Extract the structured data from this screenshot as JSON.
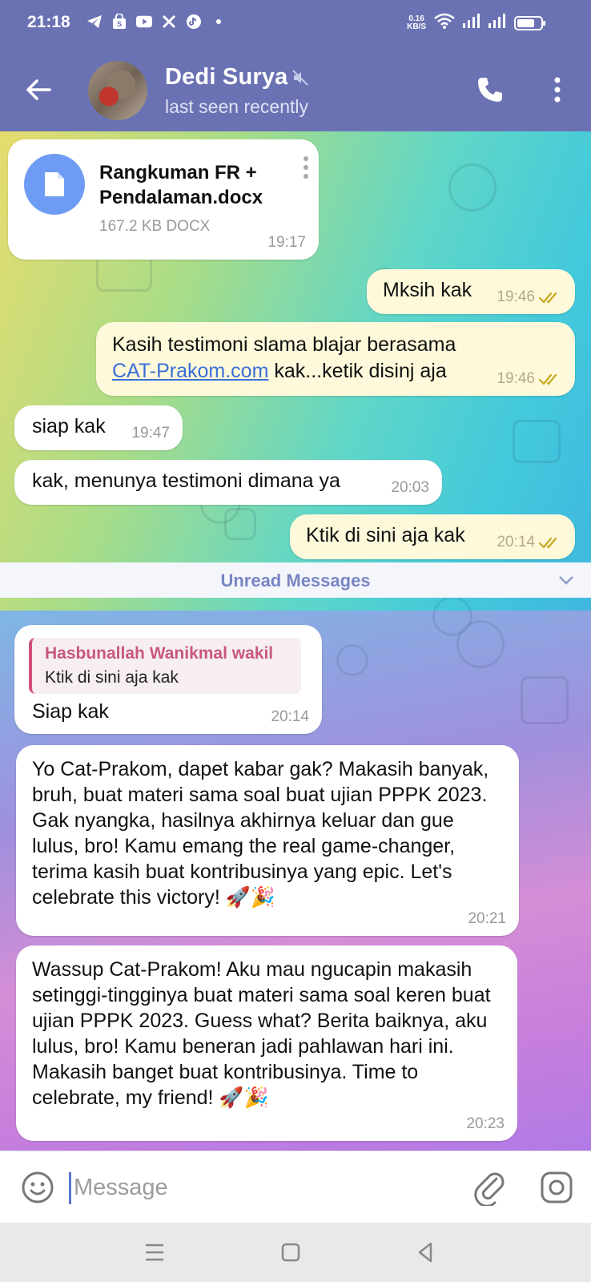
{
  "status_bar": {
    "time": "21:18",
    "speed_value": "0.16",
    "speed_unit": "KB/S",
    "battery_level": 0.75
  },
  "header": {
    "name": "Dedi Surya",
    "status": "last seen recently"
  },
  "messages": {
    "file": {
      "name_line1": "Rangkuman FR +",
      "name_line2": "Pendalaman.docx",
      "size": "167.2 KB DOCX",
      "time": "19:17"
    },
    "m1": {
      "text": "Mksih kak",
      "time": "19:46"
    },
    "m2": {
      "text_line1": "Kasih testimoni slama blajar berasama",
      "link": "CAT-Prakom.com",
      "text_line2": " kak...ketik disinj aja",
      "time": "19:46"
    },
    "m3": {
      "text": "siap kak",
      "time": "19:47"
    },
    "m4": {
      "text": "kak, menunya testimoni dimana ya",
      "time": "20:03"
    },
    "m5": {
      "text": "Ktik di sini aja kak",
      "time": "20:14"
    },
    "unread_label": "Unread Messages",
    "m6": {
      "reply_name": "Hasbunallah Wanikmal wakil",
      "reply_text": "Ktik di sini aja kak",
      "text": "Siap kak",
      "time": "20:14"
    },
    "m7": {
      "text": "Yo Cat-Prakom, dapet kabar gak? Makasih banyak, bruh, buat materi sama soal buat ujian PPPK 2023. Gak nyangka, hasilnya akhirnya keluar dan gue lulus, bro! Kamu emang the real game-changer, terima kasih buat kontribusinya yang epic. Let's celebrate this victory! 🚀🎉",
      "time": "20:21"
    },
    "m8": {
      "text": "Wassup Cat-Prakom! Aku mau ngucapin makasih setinggi-tingginya buat materi sama soal keren buat ujian PPPK 2023. Guess what? Berita baiknya, aku lulus, bro! Kamu beneran jadi pahlawan hari ini. Makasih banget buat kontribusinya. Time to celebrate, my friend! 🚀🎉",
      "time": "20:23"
    }
  },
  "input": {
    "placeholder": "Message"
  },
  "colors": {
    "header": "#6b72b4",
    "outgoing_bubble": "#fdf9da",
    "link": "#3a6fd8",
    "reply_accent": "#d2507d"
  }
}
